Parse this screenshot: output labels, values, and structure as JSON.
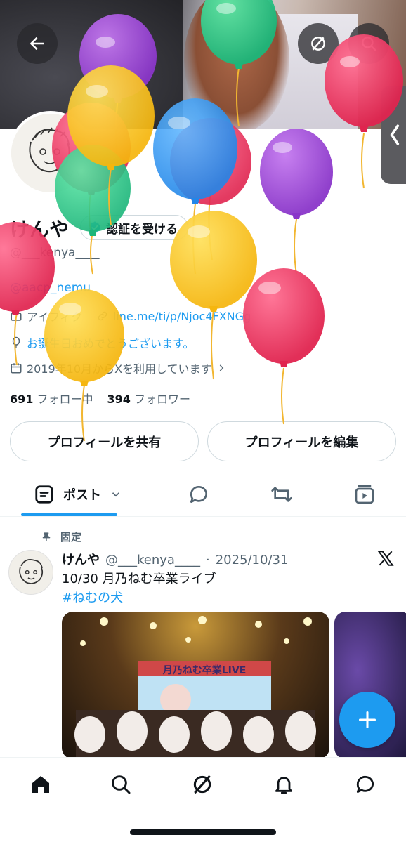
{
  "profile": {
    "display_name": "けんや",
    "verify_label": "認証を受ける",
    "handle": "@___kenya____",
    "bio_mention": "@aacp_nemu",
    "category": "アイフィク",
    "link": "line.me/ti/p/Njoc4FXNGg",
    "birthday_text": "お誕生日おめでとうございます。",
    "joined": "2019年10月からXを利用しています",
    "following_count": "691",
    "following_label": "フォロー中",
    "followers_count": "394",
    "followers_label": "フォロワー"
  },
  "actions": {
    "share_profile": "プロフィールを共有",
    "edit_profile": "プロフィールを編集"
  },
  "tabs": {
    "posts_label": "ポスト"
  },
  "post": {
    "pinned_label": "固定",
    "author_name": "けんや",
    "author_handle": "@___kenya____",
    "separator": "·",
    "date": "2025/10/31",
    "text": "10/30 月乃ねむ卒業ライブ",
    "hashtag": "#ねむの犬",
    "stage_banner_text": "月乃ねむ卒業LIVE"
  },
  "colors": {
    "accent": "#1d9bf0",
    "text": "#0f1419",
    "muted": "#536471"
  },
  "icons": [
    "back-arrow-icon",
    "grok-icon",
    "search-icon",
    "verified-badge-icon",
    "briefcase-icon",
    "link-icon",
    "balloon-icon",
    "calendar-icon",
    "chevron-right-icon",
    "posts-tab-icon",
    "chevron-down-icon",
    "replies-icon",
    "repost-icon",
    "media-icon",
    "pin-icon",
    "x-logo-icon",
    "plus-icon",
    "home-icon",
    "grok-nav-icon",
    "notifications-icon",
    "messages-icon",
    "chevron-left-icon"
  ]
}
